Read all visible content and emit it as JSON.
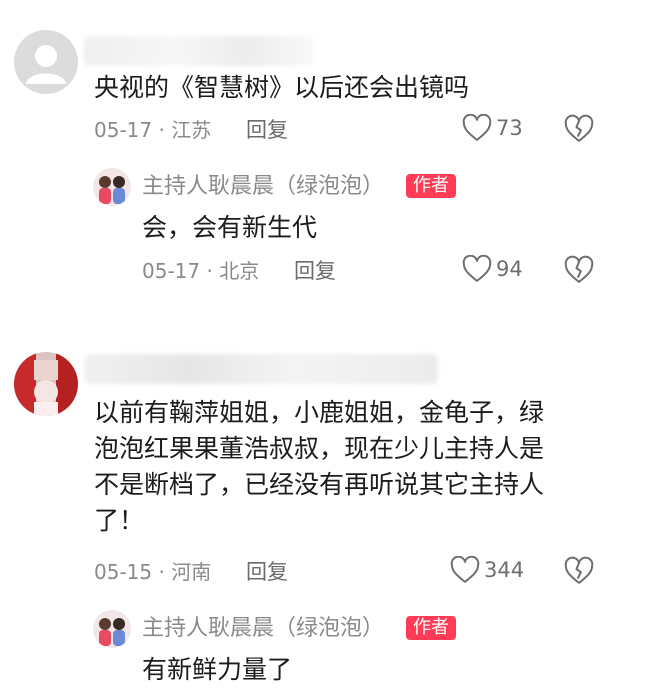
{
  "comments": [
    {
      "text": "央视的《智慧树》以后还会出镜吗",
      "date": "05-17",
      "location": "江苏",
      "reply_label": "回复",
      "likes": "73",
      "reply": {
        "author": "主持人耿晨晨（绿泡泡）",
        "tag": "作者",
        "text": "会，会有新生代",
        "date": "05-17",
        "location": "北京",
        "reply_label": "回复",
        "likes": "94"
      }
    },
    {
      "text": "以前有鞠萍姐姐，小鹿姐姐，金龟子，绿\n泡泡红果果董浩叔叔，现在少儿主持人是\n不是断档了，已经没有再听说其它主持人\n了！",
      "date": "05-15",
      "location": "河南",
      "reply_label": "回复",
      "likes": "344",
      "reply": {
        "author": "主持人耿晨晨（绿泡泡）",
        "tag": "作者",
        "text": "有新鲜力量了"
      }
    }
  ],
  "colors": {
    "author_tag_bg": "#ff3b55",
    "meta_text": "#8a8a8a",
    "primary_text": "#1c1c1c"
  },
  "icons": {
    "like": "heart-outline-icon",
    "dislike": "broken-heart-icon",
    "default_avatar": "user-silhouette-icon"
  }
}
